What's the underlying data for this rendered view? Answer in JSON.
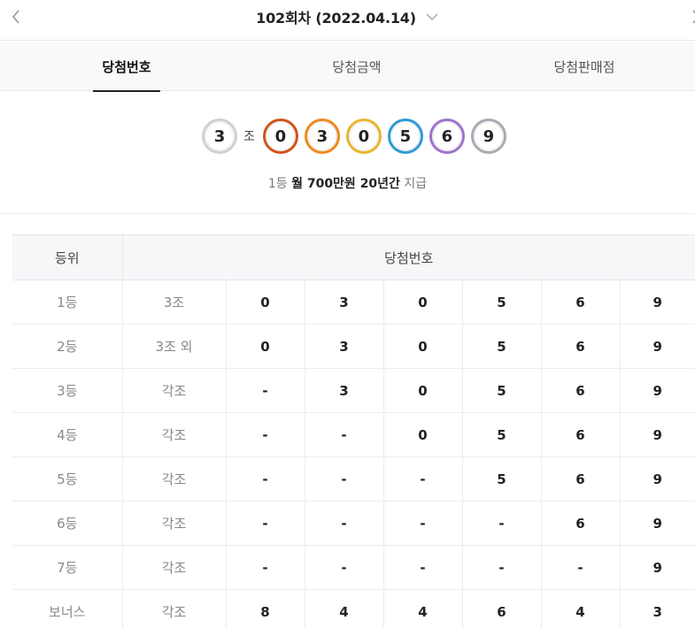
{
  "header": {
    "round_title": "102회차 (2022.04.14)",
    "prev_icon": "chevron-left-icon",
    "next_icon": "chevron-right-icon",
    "dropdown_icon": "chevron-down-icon"
  },
  "tabs": [
    {
      "label": "당첨번호",
      "active": true
    },
    {
      "label": "당첨금액",
      "active": false
    },
    {
      "label": "당첨판매점",
      "active": false
    }
  ],
  "balls": {
    "group": "3",
    "group_suffix": "조",
    "digits": [
      "0",
      "3",
      "0",
      "5",
      "6",
      "9"
    ],
    "colors": {
      "group": "#d0d0d0",
      "digits": [
        "#d2541b",
        "#ee8a1e",
        "#e9b52d",
        "#2f9ad7",
        "#9d73d0",
        "#a9abb3"
      ]
    }
  },
  "prize": {
    "rank": "1등",
    "amount": "월 700만원 20년간",
    "suffix": "지급"
  },
  "table": {
    "headers": {
      "rank": "등위",
      "numbers": "당첨번호"
    },
    "rows": [
      {
        "rank": "1등",
        "group": "3조",
        "digits": [
          "0",
          "3",
          "0",
          "5",
          "6",
          "9"
        ]
      },
      {
        "rank": "2등",
        "group": "3조 외",
        "digits": [
          "0",
          "3",
          "0",
          "5",
          "6",
          "9"
        ]
      },
      {
        "rank": "3등",
        "group": "각조",
        "digits": [
          "-",
          "3",
          "0",
          "5",
          "6",
          "9"
        ]
      },
      {
        "rank": "4등",
        "group": "각조",
        "digits": [
          "-",
          "-",
          "0",
          "5",
          "6",
          "9"
        ]
      },
      {
        "rank": "5등",
        "group": "각조",
        "digits": [
          "-",
          "-",
          "-",
          "5",
          "6",
          "9"
        ]
      },
      {
        "rank": "6등",
        "group": "각조",
        "digits": [
          "-",
          "-",
          "-",
          "-",
          "6",
          "9"
        ]
      },
      {
        "rank": "7등",
        "group": "각조",
        "digits": [
          "-",
          "-",
          "-",
          "-",
          "-",
          "9"
        ]
      },
      {
        "rank": "보너스",
        "group": "각조",
        "digits": [
          "8",
          "4",
          "4",
          "6",
          "4",
          "3"
        ]
      }
    ]
  }
}
